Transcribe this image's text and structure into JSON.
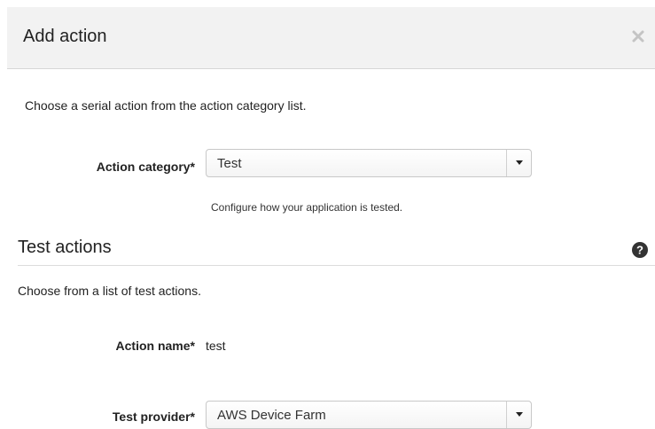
{
  "dialog": {
    "title": "Add action",
    "close_icon": "close-icon"
  },
  "intro_text": "Choose a serial action from the action category list.",
  "action_category": {
    "label": "Action category*",
    "value": "Test",
    "help_text": "Configure how your application is tested."
  },
  "test_actions": {
    "heading": "Test actions",
    "help_icon": "question-circle-icon",
    "description": "Choose from a list of test actions."
  },
  "action_name": {
    "label": "Action name*",
    "value": "test"
  },
  "test_provider": {
    "label": "Test provider*",
    "value": "AWS Device Farm"
  }
}
